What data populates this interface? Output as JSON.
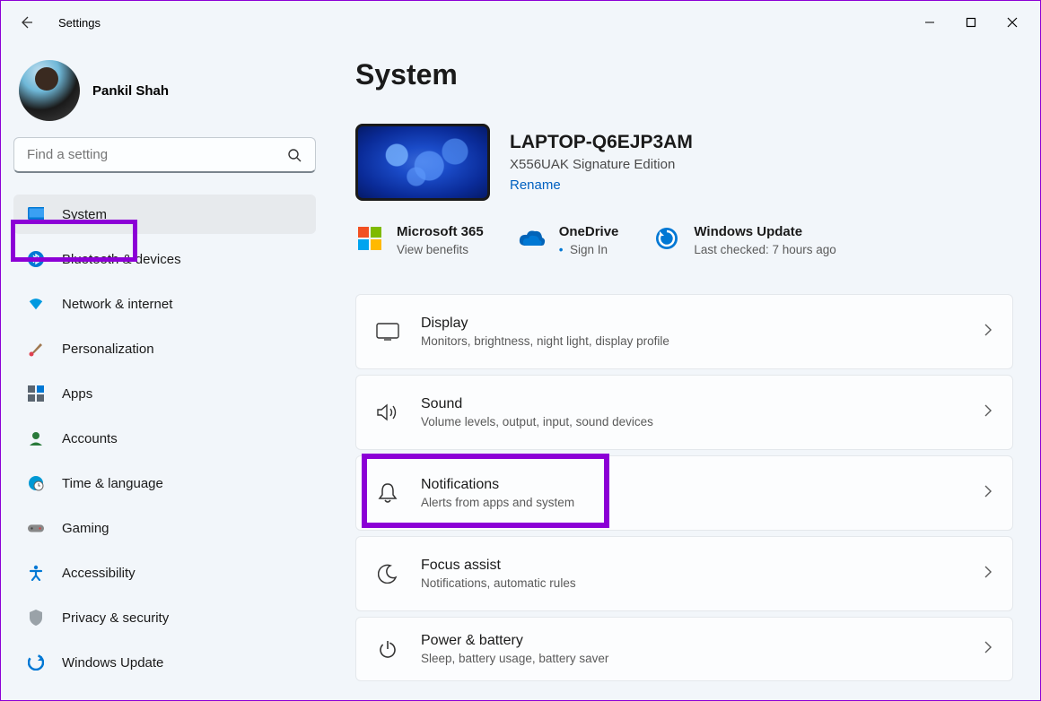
{
  "app_title": "Settings",
  "user": {
    "name": "Pankil Shah"
  },
  "search": {
    "placeholder": "Find a setting"
  },
  "sidebar": {
    "items": [
      {
        "label": "System",
        "icon": "monitor",
        "selected": true
      },
      {
        "label": "Bluetooth & devices",
        "icon": "bluetooth"
      },
      {
        "label": "Network & internet",
        "icon": "wifi"
      },
      {
        "label": "Personalization",
        "icon": "brush"
      },
      {
        "label": "Apps",
        "icon": "apps"
      },
      {
        "label": "Accounts",
        "icon": "person"
      },
      {
        "label": "Time & language",
        "icon": "clock-globe"
      },
      {
        "label": "Gaming",
        "icon": "gamepad"
      },
      {
        "label": "Accessibility",
        "icon": "accessibility"
      },
      {
        "label": "Privacy & security",
        "icon": "shield"
      },
      {
        "label": "Windows Update",
        "icon": "update"
      }
    ]
  },
  "page": {
    "title": "System",
    "device": {
      "name": "LAPTOP-Q6EJP3AM",
      "model": "X556UAK Signature Edition",
      "rename": "Rename"
    },
    "status": [
      {
        "title": "Microsoft 365",
        "sub": "View benefits",
        "icon": "ms"
      },
      {
        "title": "OneDrive",
        "sub": "Sign In",
        "icon": "cloud",
        "bullet": true
      },
      {
        "title": "Windows Update",
        "sub": "Last checked: 7 hours ago",
        "icon": "refresh"
      }
    ],
    "cards": [
      {
        "title": "Display",
        "sub": "Monitors, brightness, night light, display profile",
        "icon": "display"
      },
      {
        "title": "Sound",
        "sub": "Volume levels, output, input, sound devices",
        "icon": "sound"
      },
      {
        "title": "Notifications",
        "sub": "Alerts from apps and system",
        "icon": "bell",
        "highlighted": true
      },
      {
        "title": "Focus assist",
        "sub": "Notifications, automatic rules",
        "icon": "moon"
      },
      {
        "title": "Power & battery",
        "sub": "Sleep, battery usage, battery saver",
        "icon": "power"
      }
    ]
  }
}
